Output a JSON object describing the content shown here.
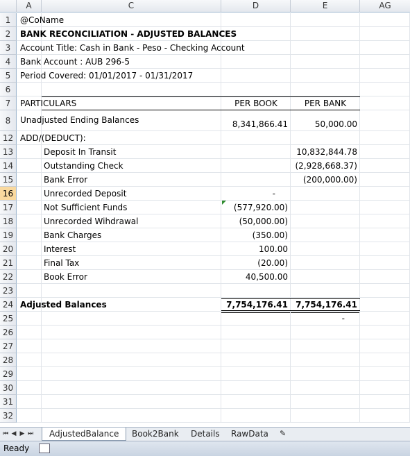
{
  "columns": [
    "A",
    "C",
    "D",
    "E",
    "AG"
  ],
  "rows": [
    {
      "num": "1",
      "label": "@CoName"
    },
    {
      "num": "2",
      "label": "BANK RECONCILIATION - ADJUSTED BALANCES"
    },
    {
      "num": "3",
      "label": "Account Title:  Cash in Bank - Peso - Checking Account"
    },
    {
      "num": "4",
      "label": "Bank Account :  AUB 296-5"
    },
    {
      "num": "5",
      "label": "Period Covered:  01/01/2017 - 01/31/2017"
    },
    {
      "num": "6",
      "label": ""
    },
    {
      "num": "7",
      "label": "PARTICULARS",
      "book": "PER BOOK",
      "bank": "PER BANK"
    },
    {
      "num": "8",
      "label": "Unadjusted Ending Balances",
      "book": "8,341,866.41",
      "bank": "50,000.00"
    },
    {
      "num": "12",
      "label": "ADD/(DEDUCT):"
    },
    {
      "num": "13",
      "label": "Deposit In Transit",
      "bank": "10,832,844.78"
    },
    {
      "num": "14",
      "label": "Outstanding Check",
      "bank": "(2,928,668.37)"
    },
    {
      "num": "15",
      "label": "Bank Error",
      "bank": "(200,000.00)"
    },
    {
      "num": "16",
      "label": "Unrecorded Deposit",
      "book": "-"
    },
    {
      "num": "17",
      "label": "Not Sufficient Funds",
      "book": "(577,920.00)"
    },
    {
      "num": "18",
      "label": "Unrecorded Wihdrawal",
      "book": "(50,000.00)"
    },
    {
      "num": "19",
      "label": "Bank Charges",
      "book": "(350.00)"
    },
    {
      "num": "20",
      "label": "Interest",
      "book": "100.00"
    },
    {
      "num": "21",
      "label": "Final Tax",
      "book": "(20.00)"
    },
    {
      "num": "22",
      "label": "Book Error",
      "book": "40,500.00"
    },
    {
      "num": "23",
      "label": ""
    },
    {
      "num": "24",
      "label": "Adjusted Balances",
      "book": "7,754,176.41",
      "bank": "7,754,176.41"
    },
    {
      "num": "25",
      "label": "",
      "bank": "-"
    },
    {
      "num": "26"
    },
    {
      "num": "27"
    },
    {
      "num": "28"
    },
    {
      "num": "29"
    },
    {
      "num": "30"
    },
    {
      "num": "31"
    },
    {
      "num": "32"
    }
  ],
  "sheet_tabs": [
    "AdjustedBalance",
    "Book2Bank",
    "Details",
    "RawData"
  ],
  "active_tab": "AdjustedBalance",
  "status": "Ready"
}
